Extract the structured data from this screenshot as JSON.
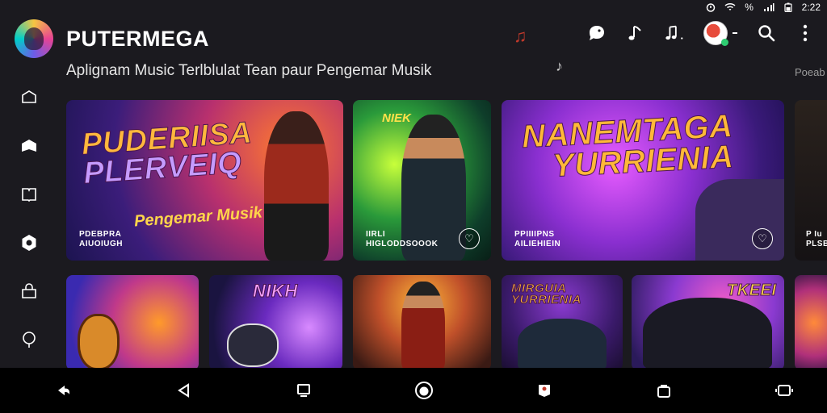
{
  "status_bar": {
    "time": "2:22",
    "battery": "%"
  },
  "header": {
    "app_title": "PUTERMEGA",
    "subtitle": "Aplignam Music Terlblulat Tean paur Pengemar Musik"
  },
  "overflow_label": "Poeab",
  "cards": {
    "featured": [
      {
        "title_line1": "PUDERIISA",
        "title_line2": "PLERVEIQ",
        "tagline": "Pengemar Musik",
        "caption_line1": "PDEBPRA",
        "caption_line2": "AIUOIUGH"
      },
      {
        "badge": "NIEK",
        "caption_line1": "IIRLI",
        "caption_line2": "HIGLODDSOOOK"
      },
      {
        "title_line1": "NANEMTAGA",
        "title_line2": "YURRIENIA",
        "caption_line1": "PPIIIIPNS",
        "caption_line2": "AILIEHIEIN"
      },
      {
        "caption_line1": "P Iu",
        "caption_line2": "PLSB"
      }
    ],
    "row2": [
      {
        "label": ""
      },
      {
        "label": "NIKH"
      },
      {
        "label": ""
      },
      {
        "label": "MIRGUIA YURRIENIA"
      },
      {
        "label": "TKEEI"
      },
      {
        "label": ""
      }
    ]
  },
  "colors": {
    "background": "#1b1a1f",
    "accent_red": "#c0392b",
    "nav_bar": "#000000"
  }
}
